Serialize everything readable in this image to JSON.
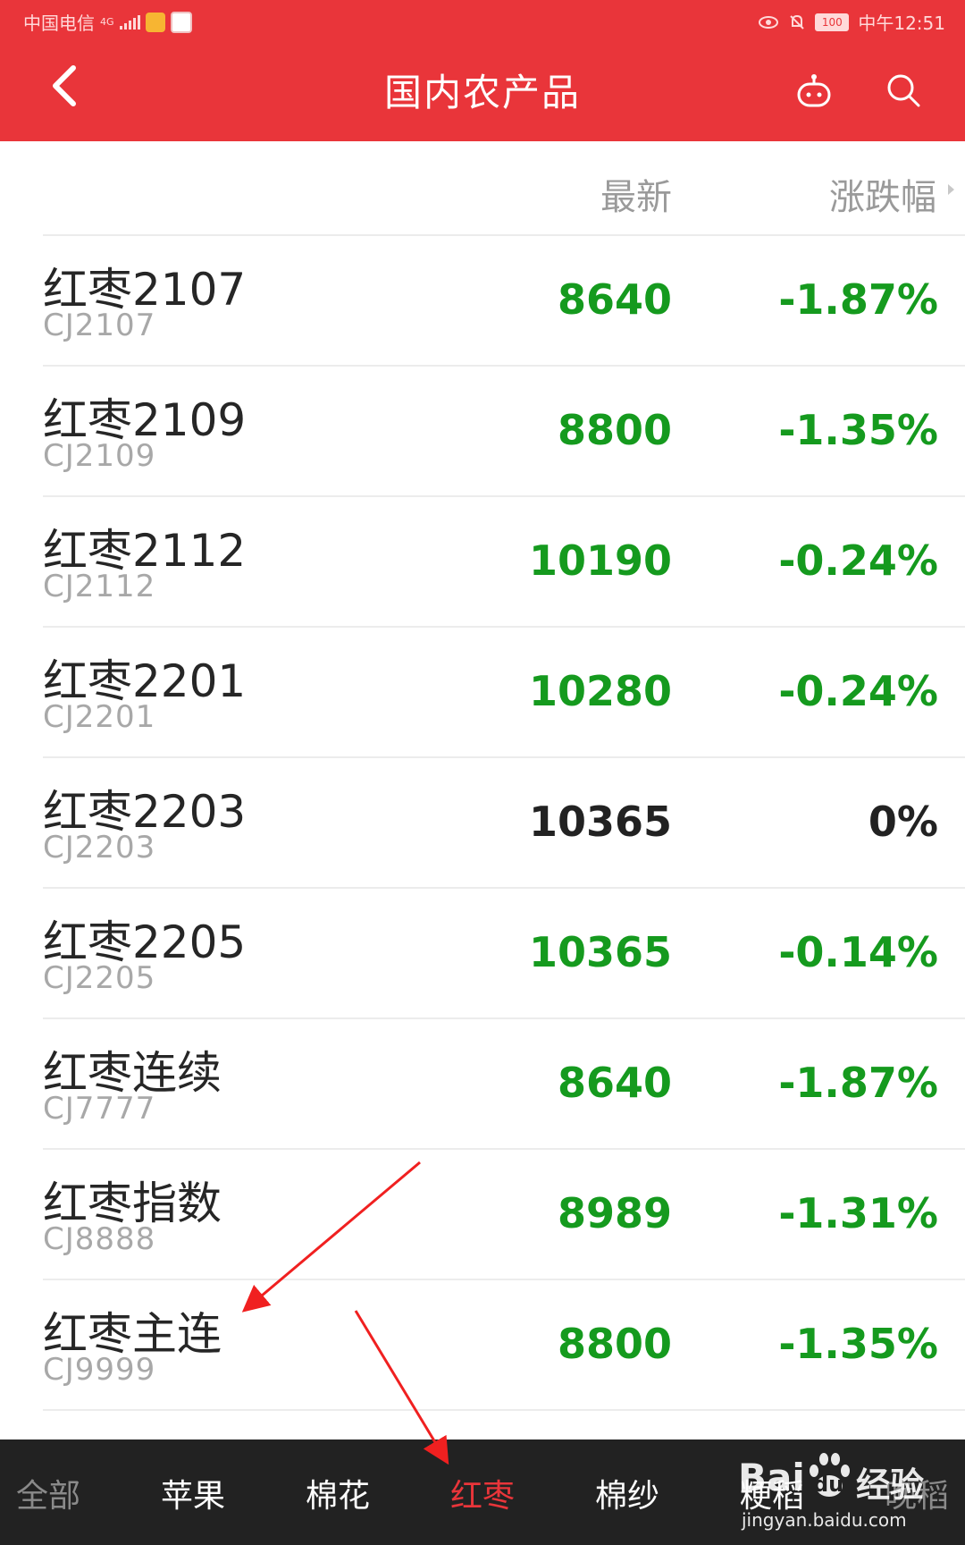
{
  "status_bar": {
    "carrier": "中国电信",
    "network": "4G",
    "battery": "100",
    "time": "中午12:51"
  },
  "header": {
    "title": "国内农产品"
  },
  "columns": {
    "latest": "最新",
    "change": "涨跌幅"
  },
  "colors": {
    "brand_red": "#e9353a",
    "down_green": "#159a1e",
    "flat_black": "#222222",
    "tabbar_bg": "#222222"
  },
  "rows": [
    {
      "name": "红枣2107",
      "code": "CJ2107",
      "price": "8640",
      "change": "-1.87%",
      "trend": "down"
    },
    {
      "name": "红枣2109",
      "code": "CJ2109",
      "price": "8800",
      "change": "-1.35%",
      "trend": "down"
    },
    {
      "name": "红枣2112",
      "code": "CJ2112",
      "price": "10190",
      "change": "-0.24%",
      "trend": "down"
    },
    {
      "name": "红枣2201",
      "code": "CJ2201",
      "price": "10280",
      "change": "-0.24%",
      "trend": "down"
    },
    {
      "name": "红枣2203",
      "code": "CJ2203",
      "price": "10365",
      "change": "0%",
      "trend": "flat"
    },
    {
      "name": "红枣2205",
      "code": "CJ2205",
      "price": "10365",
      "change": "-0.14%",
      "trend": "down"
    },
    {
      "name": "红枣连续",
      "code": "CJ7777",
      "price": "8640",
      "change": "-1.87%",
      "trend": "down"
    },
    {
      "name": "红枣指数",
      "code": "CJ8888",
      "price": "8989",
      "change": "-1.31%",
      "trend": "down"
    },
    {
      "name": "红枣主连",
      "code": "CJ9999",
      "price": "8800",
      "change": "-1.35%",
      "trend": "down"
    }
  ],
  "tabs": [
    {
      "label": "全部",
      "state": "fade"
    },
    {
      "label": "苹果",
      "state": "normal"
    },
    {
      "label": "棉花",
      "state": "normal"
    },
    {
      "label": "红枣",
      "state": "active"
    },
    {
      "label": "棉纱",
      "state": "normal"
    },
    {
      "label": "粳稻",
      "state": "normal"
    },
    {
      "label": "晚稻",
      "state": "fade"
    }
  ],
  "watermark": {
    "brand": "Bai",
    "brand2": "du",
    "cn": "经验",
    "url": "jingyan.baidu.com"
  }
}
